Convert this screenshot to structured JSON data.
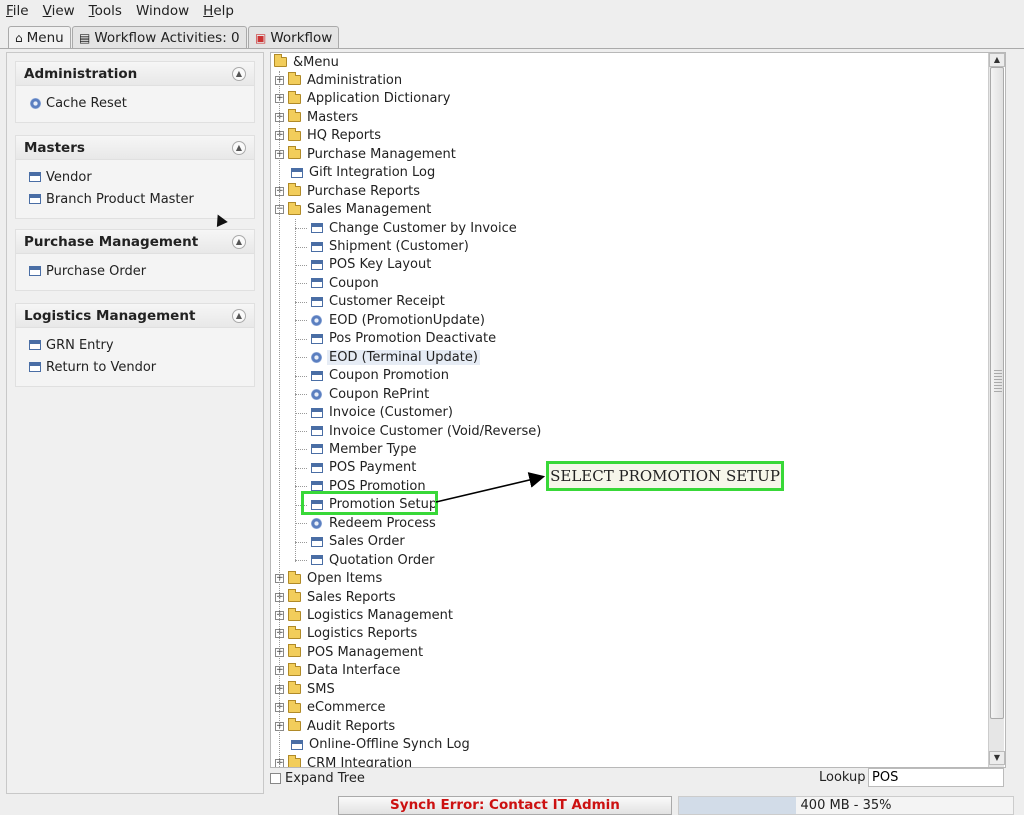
{
  "menubar": [
    {
      "u": "F",
      "rest": "ile"
    },
    {
      "u": "V",
      "rest": "iew"
    },
    {
      "u": "T",
      "rest": "ools"
    },
    {
      "u": "",
      "rest": "Window"
    },
    {
      "u": "H",
      "rest": "elp"
    }
  ],
  "tabs": {
    "menu": "Menu",
    "workflow_activities": "Workflow Activities: 0",
    "workflow": "Workflow"
  },
  "left_groups": [
    {
      "title": "Administration",
      "items": [
        {
          "label": "Cache Reset",
          "icon": "gear-icon"
        }
      ]
    },
    {
      "title": "Masters",
      "items": [
        {
          "label": "Vendor",
          "icon": "window-icon"
        },
        {
          "label": "Branch Product Master",
          "icon": "window-icon"
        }
      ]
    },
    {
      "title": "Purchase Management",
      "items": [
        {
          "label": "Purchase Order",
          "icon": "window-icon"
        }
      ]
    },
    {
      "title": "Logistics Management",
      "items": [
        {
          "label": "GRN Entry",
          "icon": "window-icon"
        },
        {
          "label": "Return to Vendor",
          "icon": "window-icon"
        }
      ]
    }
  ],
  "tree": {
    "root": "&Menu",
    "top_before": [
      {
        "label": "Administration",
        "type": "folder"
      },
      {
        "label": "Application Dictionary",
        "type": "folder"
      },
      {
        "label": "Masters",
        "type": "folder"
      },
      {
        "label": "HQ Reports",
        "type": "folder"
      },
      {
        "label": "Purchase Management",
        "type": "folder"
      },
      {
        "label": "Gift Integration Log",
        "type": "leaf"
      },
      {
        "label": "Purchase Reports",
        "type": "folder"
      },
      {
        "label": "Sales Management",
        "type": "folder-open"
      }
    ],
    "sales_children": [
      {
        "label": "Change Customer by Invoice",
        "icon": "window-icon"
      },
      {
        "label": "Shipment (Customer)",
        "icon": "window-icon"
      },
      {
        "label": "POS Key Layout",
        "icon": "window-icon"
      },
      {
        "label": "Coupon",
        "icon": "window-icon"
      },
      {
        "label": "Customer Receipt",
        "icon": "window-icon"
      },
      {
        "label": "EOD (PromotionUpdate)",
        "icon": "gear-icon"
      },
      {
        "label": "Pos Promotion Deactivate",
        "icon": "window-icon"
      },
      {
        "label": "EOD (Terminal Update)",
        "icon": "gear-icon"
      },
      {
        "label": "Coupon Promotion",
        "icon": "window-icon"
      },
      {
        "label": "Coupon RePrint",
        "icon": "gear-icon"
      },
      {
        "label": "Invoice (Customer)",
        "icon": "window-icon"
      },
      {
        "label": "Invoice Customer (Void/Reverse)",
        "icon": "window-icon"
      },
      {
        "label": "Member Type",
        "icon": "window-icon"
      },
      {
        "label": "POS Payment",
        "icon": "window-icon"
      },
      {
        "label": "POS Promotion",
        "icon": "window-icon"
      },
      {
        "label": "Promotion Setup",
        "icon": "window-icon"
      },
      {
        "label": "Redeem Process",
        "icon": "gear-icon"
      },
      {
        "label": "Sales Order",
        "icon": "window-icon"
      },
      {
        "label": "Quotation Order",
        "icon": "window-icon"
      }
    ],
    "top_after": [
      {
        "label": "Open Items",
        "type": "folder"
      },
      {
        "label": "Sales Reports",
        "type": "folder"
      },
      {
        "label": "Logistics Management",
        "type": "folder"
      },
      {
        "label": "Logistics Reports",
        "type": "folder"
      },
      {
        "label": "POS Management",
        "type": "folder"
      },
      {
        "label": "Data Interface",
        "type": "folder"
      },
      {
        "label": "SMS",
        "type": "folder"
      },
      {
        "label": "eCommerce",
        "type": "folder"
      },
      {
        "label": "Audit Reports",
        "type": "folder"
      },
      {
        "label": "Online-Offline Synch Log",
        "type": "leaf"
      },
      {
        "label": "CRM Integration",
        "type": "folder"
      }
    ]
  },
  "annotation": {
    "callout": "SELECT PROMOTION SETUP"
  },
  "bottom": {
    "expand_tree": "Expand Tree",
    "lookup_label": "Lookup",
    "lookup_value": "POS"
  },
  "status": {
    "synch_error": "Synch Error: Contact IT Admin",
    "memory": "400 MB - 35%",
    "memory_fraction": 0.35
  }
}
